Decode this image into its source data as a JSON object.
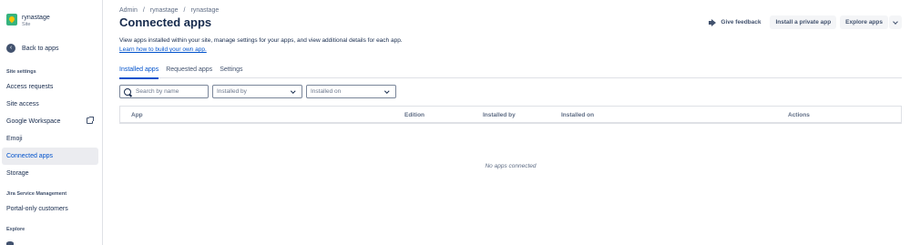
{
  "site": {
    "name": "rynastage",
    "type": "Site"
  },
  "sidebar": {
    "back_label": "Back to apps",
    "site_settings_title": "Site settings",
    "items": [
      {
        "label": "Access requests"
      },
      {
        "label": "Site access"
      },
      {
        "label": "Google Workspace"
      },
      {
        "label": "Emoji"
      },
      {
        "label": "Connected apps"
      },
      {
        "label": "Storage"
      }
    ],
    "jsm_title": "Jira Service Management",
    "jsm_items": [
      {
        "label": "Portal-only customers"
      }
    ],
    "explore_title": "Explore"
  },
  "breadcrumb": [
    "Admin",
    "/",
    "rynastage",
    "/",
    "rynastage"
  ],
  "page": {
    "title": "Connected apps",
    "description": "View apps installed within your site, manage settings for your apps, and view additional details for each app.",
    "learn_link": "Learn how to build your own app."
  },
  "actions": {
    "feedback": "Give feedback",
    "install_private": "Install a private app",
    "explore": "Explore apps"
  },
  "tabs": [
    {
      "label": "Installed apps",
      "active": true
    },
    {
      "label": "Requested apps",
      "active": false
    },
    {
      "label": "Settings",
      "active": false
    }
  ],
  "filters": {
    "search_placeholder": "Search by name",
    "installed_by": "Installed by",
    "installed_on": "Installed on"
  },
  "table": {
    "columns": [
      "App",
      "Edition",
      "Installed by",
      "Installed on",
      "Actions"
    ],
    "empty_message": "No apps connected"
  },
  "colors": {
    "accent": "#0052cc",
    "active_bg": "#ebecf0",
    "text": "#172b4d"
  }
}
